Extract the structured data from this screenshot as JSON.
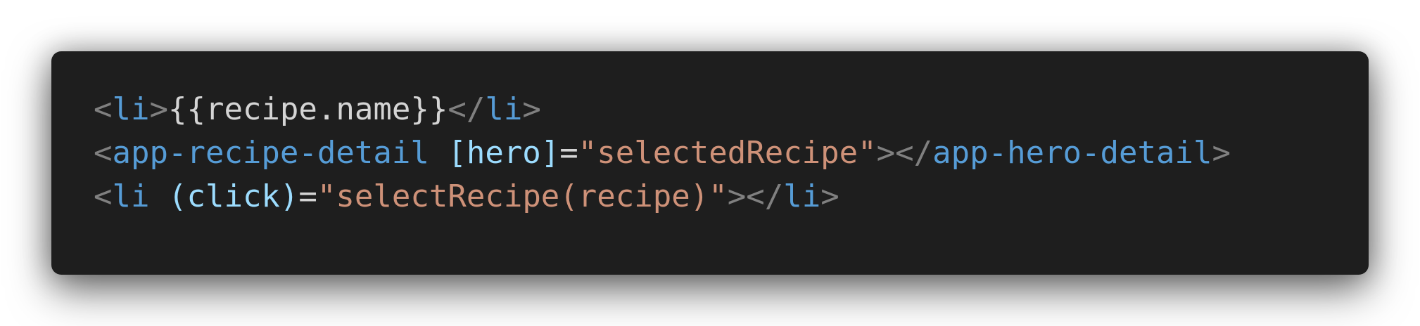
{
  "colors": {
    "background": "#1e1e1e",
    "punctuation": "#808080",
    "tag": "#569cd6",
    "text": "#d4d4d4",
    "attribute": "#9cdcfe",
    "string": "#ce9178"
  },
  "code": {
    "line1": {
      "open_lt": "<",
      "open_tag": "li",
      "open_gt": ">",
      "content": "{{recipe.name}}",
      "close_lt": "</",
      "close_tag": "li",
      "close_gt": ">"
    },
    "line2": {
      "open_lt": "<",
      "open_tag": "app-recipe-detail",
      "space": " ",
      "attr": "[hero]",
      "eq": "=",
      "value": "\"selectedRecipe\"",
      "open_gt": ">",
      "close_lt": "</",
      "close_tag": "app-hero-detail",
      "close_gt": ">"
    },
    "line3": {
      "open_lt": "<",
      "open_tag": "li",
      "space": " ",
      "attr": "(click)",
      "eq": "=",
      "value": "\"selectRecipe(recipe)\"",
      "open_gt": ">",
      "close_lt": "</",
      "close_tag": "li",
      "close_gt": ">"
    }
  }
}
